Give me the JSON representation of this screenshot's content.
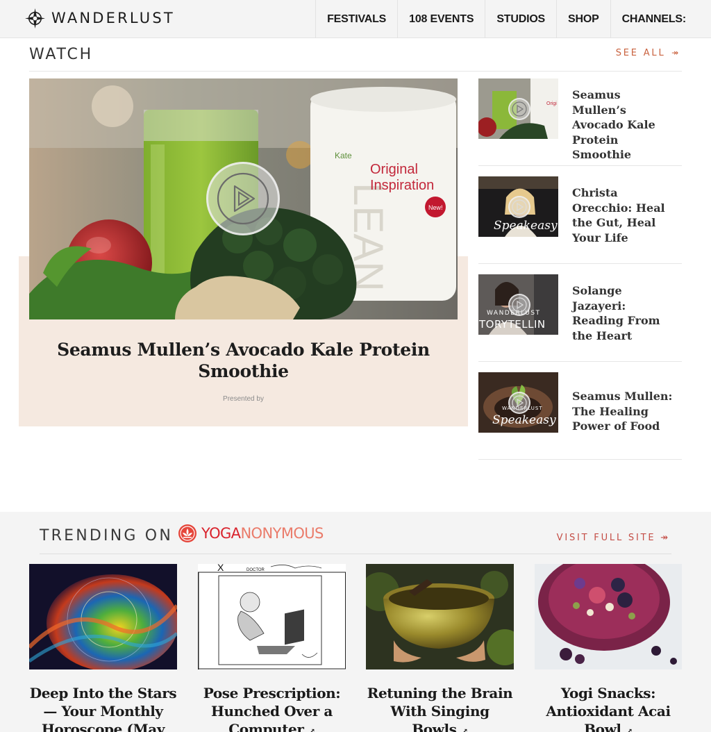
{
  "brand": {
    "name": "WANDERLUST"
  },
  "nav": {
    "items": [
      "FESTIVALS",
      "108 EVENTS",
      "STUDIOS",
      "SHOP",
      "CHANNELS:"
    ]
  },
  "watch": {
    "title": "WATCH",
    "see_all": "SEE ALL",
    "featured": {
      "title": "Seamus Mullen’s Avocado Kale Protein Smoothie",
      "presented_by": "Presented by",
      "image_text": {
        "brand_small": "Kate",
        "vertical": "LEAN",
        "product_line1": "Original",
        "product_line2": "Inspiration",
        "badge": "New!"
      }
    },
    "videos": [
      {
        "title": "Seamus Mullen’s Avocado Kale Protein Smoothie"
      },
      {
        "title": "Christa Orecchio: Heal the Gut, Heal Your Life",
        "thumb_text": "Speakeasy"
      },
      {
        "title": "Solange Jazayeri: Reading From the Heart",
        "thumb_text": "WANDERLUST",
        "thumb_text2": "TORYTELLIN"
      },
      {
        "title": "Seamus Mullen: The Healing Power of Food",
        "thumb_text": "WANDERLUST",
        "thumb_text2": "Speakeasy"
      }
    ]
  },
  "trending": {
    "label": "TRENDING ON",
    "partner_a": "YOGA",
    "partner_b": "NONYMOUS",
    "visit": "VISIT FULL SITE",
    "cards": [
      {
        "title": "Deep Into the Stars — Your Monthly Horoscope (May"
      },
      {
        "title": "Pose Prescription: Hunched Over a Computer",
        "comic_label": "DOCTOR",
        "comic_mark": "X"
      },
      {
        "title": "Retuning the Brain With Singing Bowls"
      },
      {
        "title": "Yogi Snacks: Antioxidant Acai Bowl"
      }
    ],
    "external_icon": "↗"
  },
  "colors": {
    "accent": "#c9623f",
    "feature_bg": "#f5e9e0",
    "yoga_red": "#d9232d"
  },
  "icons": [
    "compass-logo-icon",
    "play-icon",
    "arrow-right-icon",
    "external-link-icon",
    "lotus-logo-icon"
  ]
}
